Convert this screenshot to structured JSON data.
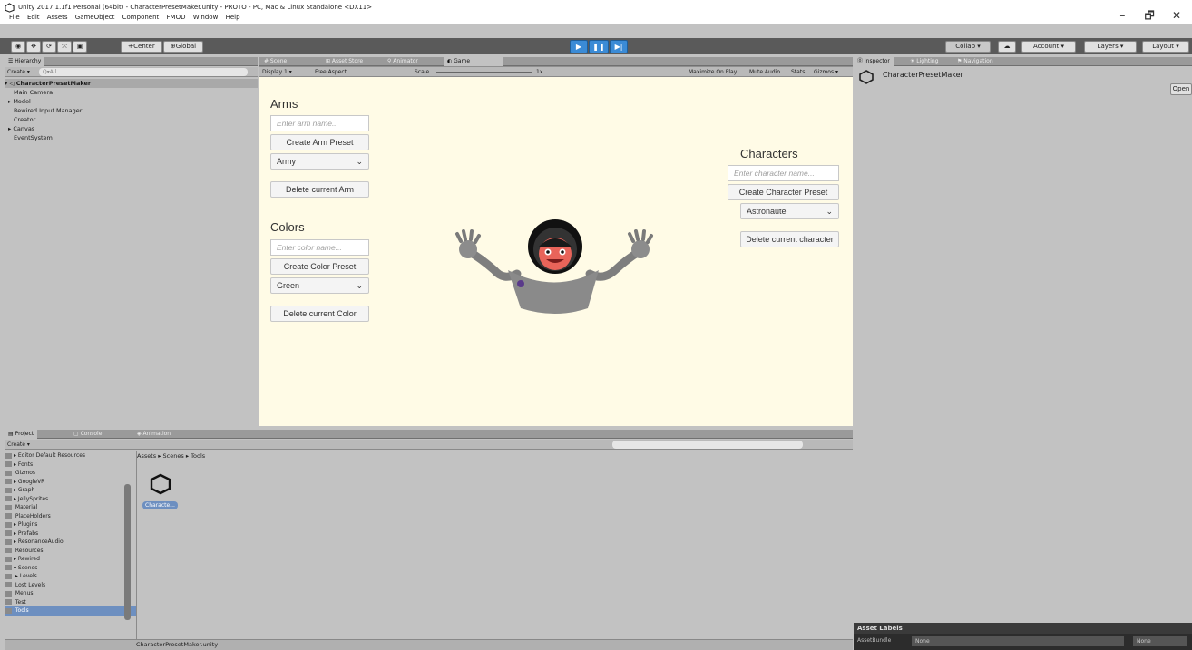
{
  "window": {
    "title": "Unity 2017.1.1f1 Personal (64bit) - CharacterPresetMaker.unity - PROTO - PC, Mac & Linux Standalone <DX11>",
    "menu": [
      "File",
      "Edit",
      "Assets",
      "GameObject",
      "Component",
      "FMOD",
      "Window",
      "Help"
    ],
    "controls": [
      "–",
      "🗗",
      "✕"
    ]
  },
  "toolbar": {
    "tools": [
      "◉",
      "✥",
      "⟳",
      "⤧",
      "▣"
    ],
    "pivot": "⁜Center",
    "space": "⊕Global",
    "play": [
      "▶",
      "❚❚",
      "▶|"
    ],
    "collab": "Collab ▾",
    "cloud": "☁",
    "account": "Account ▾",
    "layers": "Layers ▾",
    "layout": "Layout ▾"
  },
  "hierarchy": {
    "tab": "☰ Hierarchy",
    "create": "Create ▾",
    "search_placeholder": "Q▾All",
    "scene": "▾ ◁ CharacterPresetMaker",
    "items": [
      "Main Camera",
      "▸ Model",
      "Rewired Input Manager",
      "Creator",
      "▸ Canvas",
      "EventSystem"
    ]
  },
  "scene_tabs": {
    "tabs": [
      "# Scene",
      "⊞ Asset Store",
      "⚲ Animator",
      "◐ Game"
    ],
    "display": "Display 1 ▾",
    "aspect": "Free Aspect",
    "scale_label": "Scale",
    "scale_value": "1x",
    "options": [
      "Maximize On Play",
      "Mute Audio",
      "Stats",
      "Gizmos ▾"
    ]
  },
  "game_ui": {
    "arms": {
      "heading": "Arms",
      "input_placeholder": "Enter arm name...",
      "create_button": "Create Arm Preset",
      "dropdown_value": "Army",
      "delete_button": "Delete current Arm"
    },
    "colors": {
      "heading": "Colors",
      "input_placeholder": "Enter color name...",
      "create_button": "Create Color Preset",
      "dropdown_value": "Green",
      "delete_button": "Delete current Color"
    },
    "characters": {
      "heading": "Characters",
      "input_placeholder": "Enter character name...",
      "create_button": "Create Character Preset",
      "dropdown_value": "Astronaute",
      "delete_button": "Delete current character"
    }
  },
  "inspector": {
    "tabs": [
      "⓪ Inspector",
      "☀ Lighting",
      "⚑ Navigation"
    ],
    "object_name": "CharacterPresetMaker",
    "open_button": "Open",
    "asset_labels": "Asset Labels",
    "assetbundle_label": "AssetBundle",
    "assetbundle_value": "None",
    "variant_value": "None"
  },
  "project": {
    "tabs": [
      "▤ Project",
      "▢ Console",
      "◈ Animation"
    ],
    "create": "Create ▾",
    "path": "Assets ▸ Scenes ▸ Tools",
    "folders": [
      {
        "label": "▸ Editor Default Resources",
        "selected": false
      },
      {
        "label": "▸ Fonts",
        "selected": false
      },
      {
        "label": "  Gizmos",
        "selected": false
      },
      {
        "label": "▸ GoogleVR",
        "selected": false
      },
      {
        "label": "▸ Graph",
        "selected": false
      },
      {
        "label": "▸ JellySprites",
        "selected": false
      },
      {
        "label": "  Material",
        "selected": false
      },
      {
        "label": "  PlaceHolders",
        "selected": false
      },
      {
        "label": "▸ Plugins",
        "selected": false
      },
      {
        "label": "▸ Prefabs",
        "selected": false
      },
      {
        "label": "▸ ResonanceAudio",
        "selected": false
      },
      {
        "label": "  Resources",
        "selected": false
      },
      {
        "label": "▸ Rewired",
        "selected": false
      },
      {
        "label": "▾ Scenes",
        "selected": false
      },
      {
        "label": "  ▸ Levels",
        "selected": false
      },
      {
        "label": "    Lost Levels",
        "selected": false
      },
      {
        "label": "    Menus",
        "selected": false
      },
      {
        "label": "    Test",
        "selected": false
      },
      {
        "label": "    Tools",
        "selected": true
      }
    ],
    "asset_name": "Characte...",
    "status_file": "CharacterPresetMaker.unity"
  },
  "colors": {
    "game_bg": "#fffbe6",
    "editor_bg": "#c2c2c2",
    "play_blue": "#3b8bd6"
  }
}
